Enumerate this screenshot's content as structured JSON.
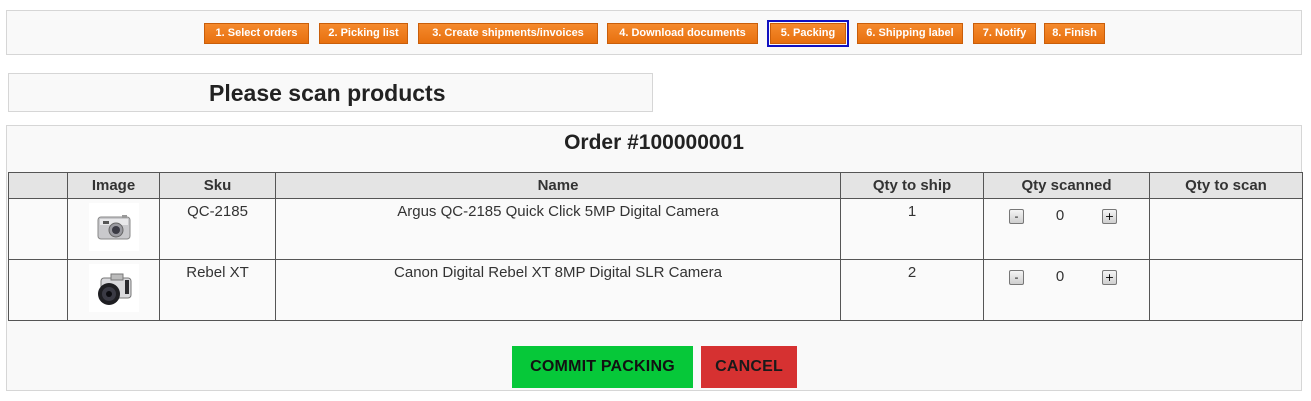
{
  "steps": [
    {
      "label": "1. Select orders"
    },
    {
      "label": "2. Picking list"
    },
    {
      "label": "3. Create shipments/invoices"
    },
    {
      "label": "4. Download documents"
    },
    {
      "label": "5. Packing",
      "active": true
    },
    {
      "label": "6. Shipping label"
    },
    {
      "label": "7. Notify"
    },
    {
      "label": "8. Finish"
    }
  ],
  "scan_prompt": "Please scan products",
  "order": {
    "title": "Order #100000001",
    "columns": [
      "",
      "Image",
      "Sku",
      "Name",
      "Qty to ship",
      "Qty scanned",
      "Qty to scan"
    ],
    "rows": [
      {
        "sku": "QC-2185",
        "name": "Argus QC-2185 Quick Click 5MP Digital Camera",
        "qty_to_ship": "1",
        "qty_scanned": "0",
        "qty_to_scan": "",
        "image": "compact-camera-icon",
        "minus": "-",
        "plus": "+"
      },
      {
        "sku": "Rebel XT",
        "name": "Canon Digital Rebel XT 8MP Digital SLR Camera",
        "qty_to_ship": "2",
        "qty_scanned": "0",
        "qty_to_scan": "",
        "image": "slr-camera-icon",
        "minus": "-",
        "plus": "+"
      }
    ]
  },
  "actions": {
    "commit_label": "COMMIT PACKING",
    "cancel_label": "CANCEL"
  },
  "colors": {
    "step_orange": "#f07f1e",
    "active_outline": "#1010c0",
    "commit_green": "#06c839",
    "cancel_red": "#d63131"
  }
}
